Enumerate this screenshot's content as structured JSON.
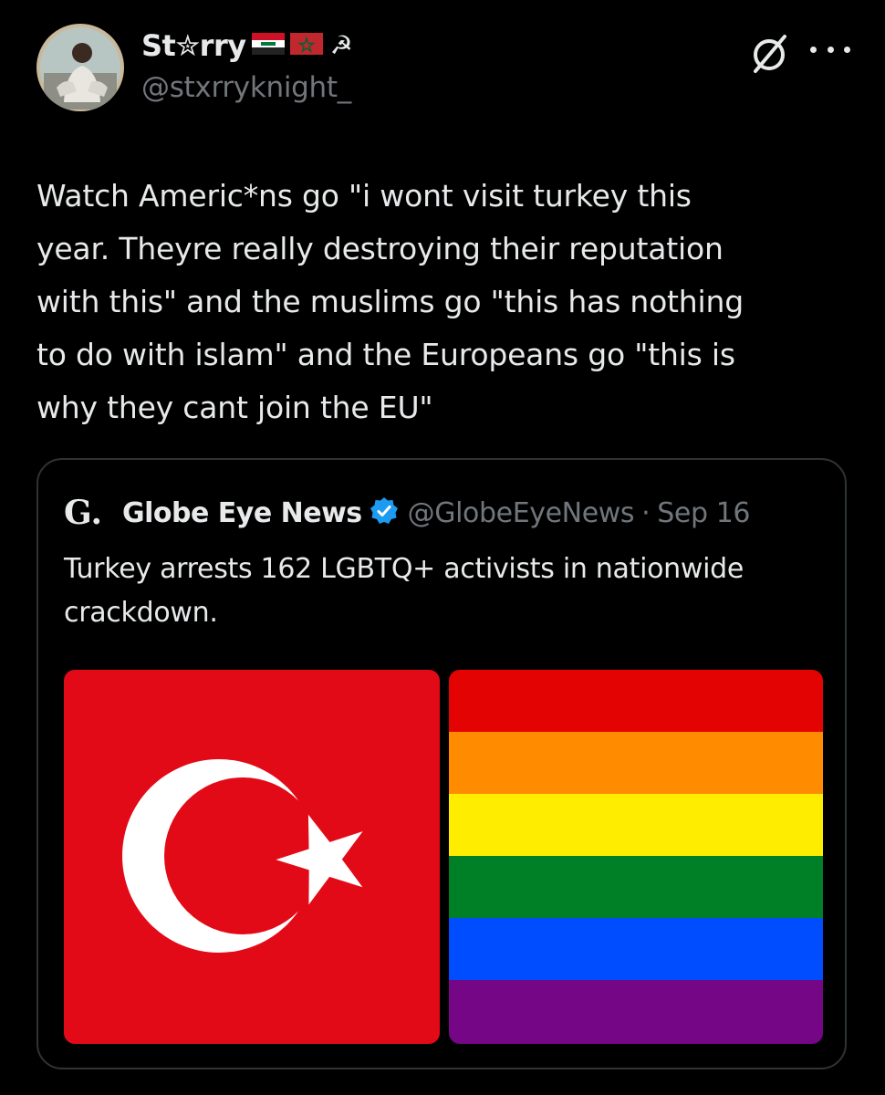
{
  "author": {
    "display_name": "St✮rry",
    "flags": [
      "iraq-flag-icon",
      "morocco-flag-icon"
    ],
    "symbol": "☭",
    "handle": "@stxrryknight_"
  },
  "tweet": {
    "text": "Watch Americ*ns go \"i wont visit turkey this\nyear. Theyre really destroying their reputation\nwith this\" and the muslims go \"this has nothing\nto do with islam\" and the Europeans go \"this is\nwhy they cant join the EU\""
  },
  "quoted_tweet": {
    "logo": "G.",
    "name": "Globe Eye News",
    "handle": "@GlobeEyeNews",
    "separator": "·",
    "date": "Sep 16",
    "text": "Turkey arrests 162 LGBTQ+ activists in nationwide crackdown.",
    "media": [
      {
        "name": "turkey-flag-image",
        "color": "#e30a17"
      },
      {
        "name": "rainbow-flag-image",
        "colors": [
          "#e40303",
          "#ff8c00",
          "#ffed00",
          "#008026",
          "#004dff",
          "#750787"
        ]
      }
    ]
  },
  "colors": {
    "background": "#000000",
    "text_primary": "#e7e9ea",
    "text_secondary": "#71767b",
    "border": "#2f3336",
    "verified": "#1d9bf0"
  }
}
